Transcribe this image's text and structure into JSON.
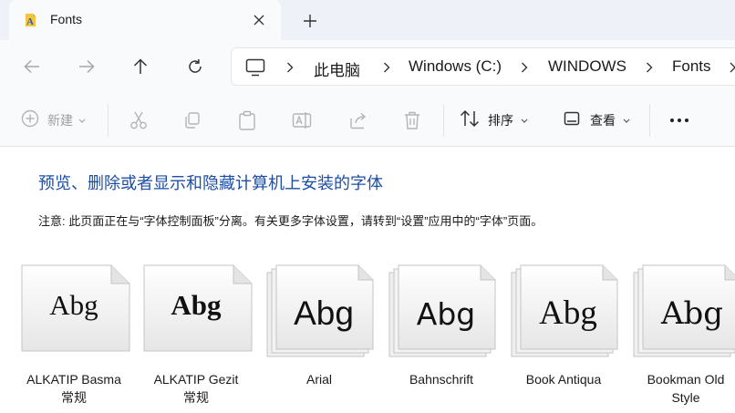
{
  "tab": {
    "title": "Fonts",
    "icon": "fonts-folder-icon"
  },
  "breadcrumb": [
    "此电脑",
    "Windows (C:)",
    "WINDOWS",
    "Fonts"
  ],
  "toolbar": {
    "new_label": "新建",
    "sort_label": "排序",
    "view_label": "查看"
  },
  "page": {
    "heading": "预览、删除或者显示和隐藏计算机上安装的字体",
    "note": "注意: 此页面正在与“字体控制面板”分离。有关更多字体设置，请转到“设置”应用中的“字体”页面。"
  },
  "fonts": [
    {
      "name": "ALKATIP Basma",
      "style": "常规",
      "sample": "Abg"
    },
    {
      "name": "ALKATIP Gezit",
      "style": "常规",
      "sample": "Abg"
    },
    {
      "name": "Arial",
      "style": "",
      "sample": "Abg"
    },
    {
      "name": "Bahnschrift",
      "style": "",
      "sample": "Abg"
    },
    {
      "name": "Book Antiqua",
      "style": "",
      "sample": "Abg"
    },
    {
      "name": "Bookman Old",
      "style": "Style",
      "sample": "Abg"
    }
  ],
  "colors": {
    "heading": "#1c4ea5",
    "tabstrip": "#eef2f8",
    "toolbar": "#f9fafc"
  }
}
